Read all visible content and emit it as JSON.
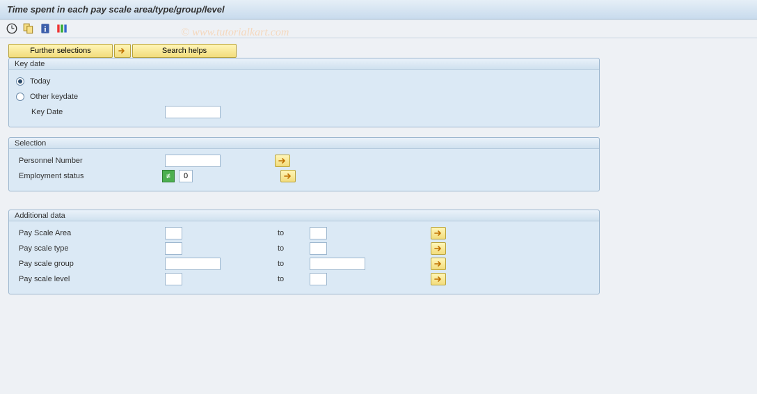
{
  "header": {
    "title": "Time spent in each pay scale area/type/group/level"
  },
  "watermark": "© www.tutorialkart.com",
  "toolbar": {
    "icons": [
      "execute-icon",
      "variant-icon",
      "info-icon",
      "columns-icon"
    ]
  },
  "buttons": {
    "further_selections": "Further selections",
    "search_helps": "Search helps"
  },
  "groups": {
    "keydate": {
      "title": "Key date",
      "today_label": "Today",
      "other_label": "Other keydate",
      "keydate_label": "Key Date",
      "keydate_value": ""
    },
    "selection": {
      "title": "Selection",
      "personnel_number_label": "Personnel Number",
      "personnel_number_value": "",
      "employment_status_label": "Employment status",
      "employment_status_value": "0"
    },
    "additional": {
      "title": "Additional data",
      "to_label": "to",
      "rows": [
        {
          "label": "Pay Scale Area",
          "from": "",
          "to": "",
          "from_w": "w25",
          "to_w": "w25"
        },
        {
          "label": "Pay scale type",
          "from": "",
          "to": "",
          "from_w": "w25",
          "to_w": "w25"
        },
        {
          "label": "Pay scale group",
          "from": "",
          "to": "",
          "from_w": "w80",
          "to_w": "w80"
        },
        {
          "label": "Pay scale level",
          "from": "",
          "to": "",
          "from_w": "w25",
          "to_w": "w25"
        }
      ]
    }
  }
}
